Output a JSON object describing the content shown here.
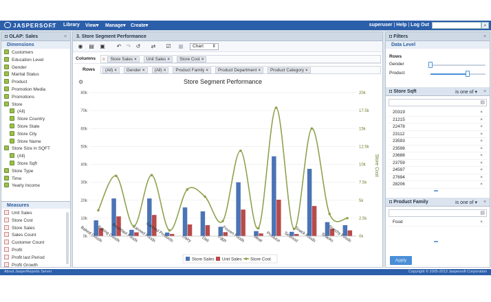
{
  "topbar": {
    "logo": "JASPERSOFT",
    "menus": [
      "Library",
      "View",
      "Manage",
      "Create"
    ],
    "user": "superuser",
    "help": "Help",
    "logout": "Log Out",
    "separator": "|"
  },
  "left_panel": {
    "title": "OLAP: Sales",
    "dimensions_title": "Dimensions",
    "dimensions": [
      "Customers",
      "Education Level",
      "Gender",
      "Marital Status",
      "Product",
      "Promotion Media",
      "Promotions",
      "Store",
      "(All)",
      "Store Country",
      "Store State",
      "Store City",
      "Store Name",
      "Store Size in SQFT",
      "(All)",
      "Store Sqft",
      "Store Type",
      "Time",
      "Yearly Income"
    ],
    "measures_title": "Measures",
    "measures": [
      "Unit Sales",
      "Store Cost",
      "Store Sales",
      "Sales Count",
      "Customer Count",
      "Profit",
      "Profit last Period",
      "Profit Growth"
    ]
  },
  "center": {
    "title": "3. Store Segment Performance",
    "chart_type_select": "Chart",
    "columns_label": "Columns",
    "columns": [
      "Store Sales",
      "Unit Sales",
      "Store Cost"
    ],
    "rows_label": "Rows",
    "rows": [
      "(All)",
      "Gender",
      "(All)",
      "Product Family",
      "Product Department",
      "Product Category"
    ],
    "chip_remove": "×"
  },
  "chart_data": {
    "type": "bar",
    "title": "Store Segment Performance",
    "categories": [
      "Baked Goods",
      "Baking Goods",
      "Breakfast Foods",
      "Canned Foods",
      "Canned Products",
      "Dairy",
      "Deli",
      "Eggs",
      "Frozen Foods",
      "Meat",
      "Produce",
      "Seafood",
      "Snack Foods",
      "Snacks",
      "Starchy Foods"
    ],
    "series": [
      {
        "name": "Store Sales",
        "axis": "left",
        "type": "bar",
        "color": "#4a74b5",
        "values": [
          8800,
          21000,
          3500,
          21000,
          2000,
          16000,
          13800,
          5200,
          30000,
          2800,
          44500,
          2400,
          37500,
          7800,
          6100
        ]
      },
      {
        "name": "Unit Sales",
        "axis": "left",
        "type": "bar",
        "color": "#b94a4a",
        "values": [
          4400,
          11000,
          2100,
          11800,
          1200,
          6500,
          6100,
          2200,
          14800,
          1500,
          20300,
          1200,
          16800,
          4000,
          3200
        ]
      },
      {
        "name": "Store Cost",
        "axis": "right",
        "type": "line",
        "color": "#8ea14d",
        "values": [
          3600,
          8400,
          1400,
          8500,
          800,
          6500,
          5500,
          2100,
          11900,
          1100,
          17900,
          1000,
          15000,
          3100,
          2500
        ]
      }
    ],
    "left_axis": {
      "ticks": [
        "0k",
        "10k",
        "20k",
        "30k",
        "40k",
        "50k",
        "60k",
        "70k",
        "80k"
      ],
      "ylim": [
        0,
        80000
      ]
    },
    "right_axis": {
      "label": "Store Cost",
      "ticks": [
        "0k",
        "2.5k",
        "5k",
        "7.5k",
        "10k",
        "12.5k",
        "15k",
        "17.5k",
        "20k"
      ],
      "ylim": [
        0,
        20000
      ]
    },
    "legend": "bottom"
  },
  "right_panel": {
    "title": "Filters",
    "data_level": "Data Level",
    "rows_label": "Rows",
    "sliders": [
      {
        "label": "Gender",
        "level": 0.0
      },
      {
        "label": "Product",
        "level": 0.67
      }
    ],
    "store_sqft": {
      "title": "Store Sqft",
      "condition": "is one of",
      "values": [
        "20319",
        "21215",
        "22478",
        "23112",
        "23593",
        "23598",
        "23688",
        "23759",
        "24597",
        "27694",
        "28206"
      ]
    },
    "product_family": {
      "title": "Product Family",
      "condition": "is one of",
      "values": [
        "Food"
      ]
    },
    "apply": "Apply"
  },
  "footer": {
    "left": "About JasperReports Server",
    "right": "Copyright © 2005-2013 Jaspersoft Corporation"
  }
}
